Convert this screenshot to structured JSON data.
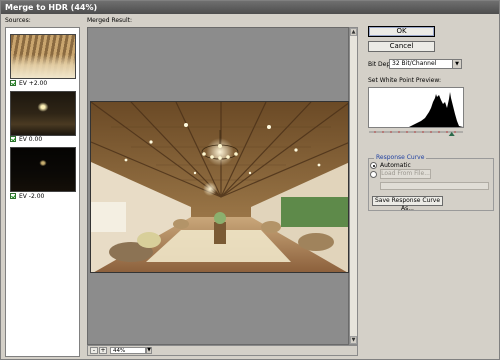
{
  "window": {
    "title": "Merge to HDR (44%)"
  },
  "sources": {
    "label": "Sources:",
    "items": [
      {
        "checked": true,
        "label": "EV +2.00"
      },
      {
        "checked": true,
        "label": "EV 0.00"
      },
      {
        "checked": true,
        "label": "EV -2.00"
      }
    ]
  },
  "preview": {
    "label": "Merged Result:",
    "zoom": "44%",
    "zoom_out": "-",
    "zoom_in": "+",
    "scroll_up": "▲",
    "scroll_down": "▼",
    "dropdown_arrow": "▼"
  },
  "buttons": {
    "ok": "OK",
    "cancel": "Cancel"
  },
  "bit_depth": {
    "label": "Bit Depth:",
    "value": "32 Bit/Channel",
    "arrow": "▼"
  },
  "white_point": {
    "label": "Set White Point Preview:",
    "slider_position": 0.88
  },
  "response_curve": {
    "title": "Response Curve",
    "options": [
      {
        "label": "Automatic",
        "selected": true
      }
    ],
    "load_button": "Load From File...",
    "save_button": "Save Response Curve As..."
  },
  "colors": {
    "window_bg": "#d4d0c8",
    "titlebar": "#5e5e5e",
    "preview_bg": "#8c8c8c",
    "group_title": "#1e3fa0"
  }
}
